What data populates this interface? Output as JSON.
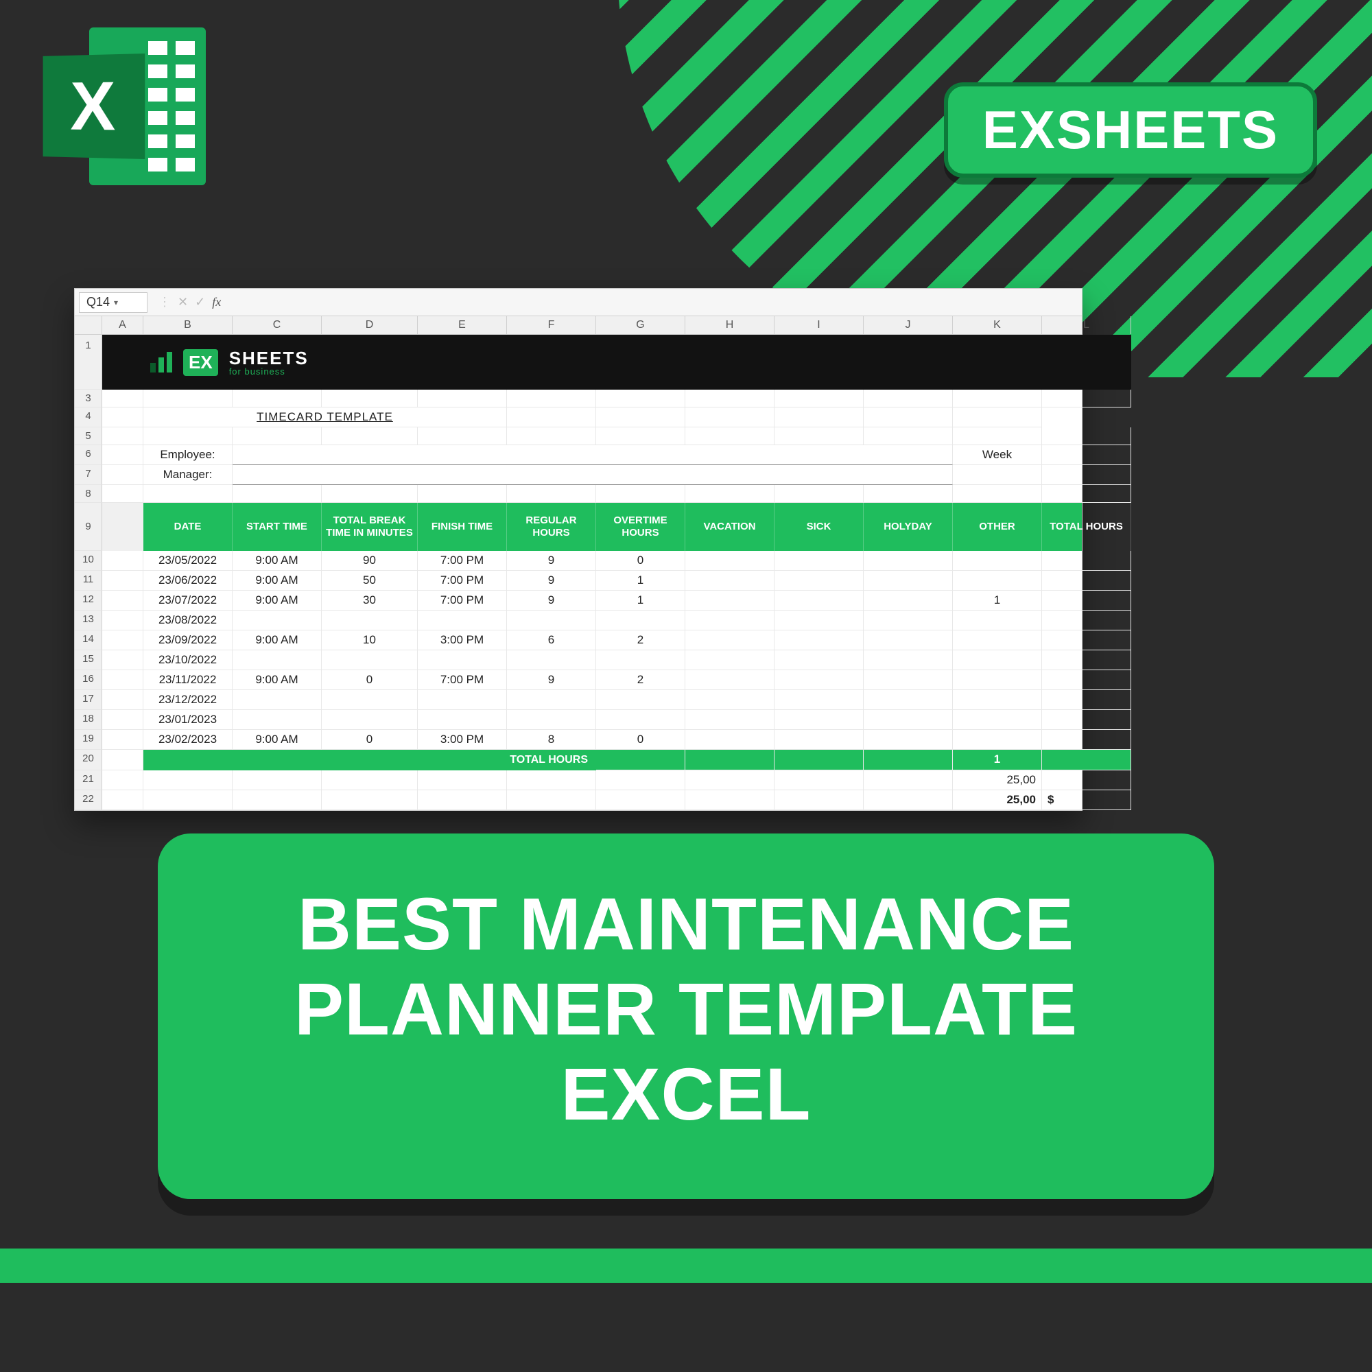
{
  "brand": {
    "pill": "EXSHEETS",
    "excel_letter": "X"
  },
  "banner": {
    "ex": "EX",
    "title": "SHEETS",
    "subtitle": "for business"
  },
  "formula_bar": {
    "cell_ref": "Q14",
    "fx": "fx"
  },
  "columns": [
    "",
    "A",
    "B",
    "C",
    "D",
    "E",
    "F",
    "G",
    "H",
    "I",
    "J",
    "K",
    "L"
  ],
  "template": {
    "title": "TIMECARD TEMPLATE",
    "employee_label": "Employee:",
    "manager_label": "Manager:",
    "week_label": "Week"
  },
  "headers": [
    "DATE",
    "START TIME",
    "TOTAL BREAK TIME IN MINUTES",
    "FINISH TIME",
    "REGULAR HOURS",
    "OVERTIME HOURS",
    "VACATION",
    "SICK",
    "HOLYDAY",
    "OTHER",
    "TOTAL HOURS"
  ],
  "row_numbers": [
    "1",
    "3",
    "4",
    "5",
    "6",
    "7",
    "8",
    "9",
    "10",
    "11",
    "12",
    "13",
    "14",
    "15",
    "16",
    "17",
    "18",
    "19",
    "20",
    "21",
    "22"
  ],
  "rows": [
    {
      "date": "23/05/2022",
      "start": "9:00 AM",
      "break": "90",
      "finish": "7:00 PM",
      "reg": "9",
      "ot": "0",
      "vac": "",
      "sick": "",
      "hol": "",
      "other": "",
      "total": ""
    },
    {
      "date": "23/06/2022",
      "start": "9:00 AM",
      "break": "50",
      "finish": "7:00 PM",
      "reg": "9",
      "ot": "1",
      "vac": "",
      "sick": "",
      "hol": "",
      "other": "",
      "total": ""
    },
    {
      "date": "23/07/2022",
      "start": "9:00 AM",
      "break": "30",
      "finish": "7:00 PM",
      "reg": "9",
      "ot": "1",
      "vac": "",
      "sick": "",
      "hol": "",
      "other": "1",
      "total": ""
    },
    {
      "date": "23/08/2022",
      "start": "",
      "break": "",
      "finish": "",
      "reg": "",
      "ot": "",
      "vac": "",
      "sick": "",
      "hol": "",
      "other": "",
      "total": ""
    },
    {
      "date": "23/09/2022",
      "start": "9:00 AM",
      "break": "10",
      "finish": "3:00 PM",
      "reg": "6",
      "ot": "2",
      "vac": "",
      "sick": "",
      "hol": "",
      "other": "",
      "total": ""
    },
    {
      "date": "23/10/2022",
      "start": "",
      "break": "",
      "finish": "",
      "reg": "",
      "ot": "",
      "vac": "",
      "sick": "",
      "hol": "",
      "other": "",
      "total": ""
    },
    {
      "date": "23/11/2022",
      "start": "9:00 AM",
      "break": "0",
      "finish": "7:00 PM",
      "reg": "9",
      "ot": "2",
      "vac": "",
      "sick": "",
      "hol": "",
      "other": "",
      "total": ""
    },
    {
      "date": "23/12/2022",
      "start": "",
      "break": "",
      "finish": "",
      "reg": "",
      "ot": "",
      "vac": "",
      "sick": "",
      "hol": "",
      "other": "",
      "total": ""
    },
    {
      "date": "23/01/2023",
      "start": "",
      "break": "",
      "finish": "",
      "reg": "",
      "ot": "",
      "vac": "",
      "sick": "",
      "hol": "",
      "other": "",
      "total": ""
    },
    {
      "date": "23/02/2023",
      "start": "9:00 AM",
      "break": "0",
      "finish": "3:00 PM",
      "reg": "8",
      "ot": "0",
      "vac": "",
      "sick": "",
      "hol": "",
      "other": "",
      "total": ""
    }
  ],
  "totals_label": "TOTAL HOURS",
  "summary": {
    "other_total": "1",
    "amount1": "25,00",
    "amount2": "25,00",
    "currency": "$"
  },
  "title_card": "BEST MAINTENANCE PLANNER TEMPLATE EXCEL"
}
